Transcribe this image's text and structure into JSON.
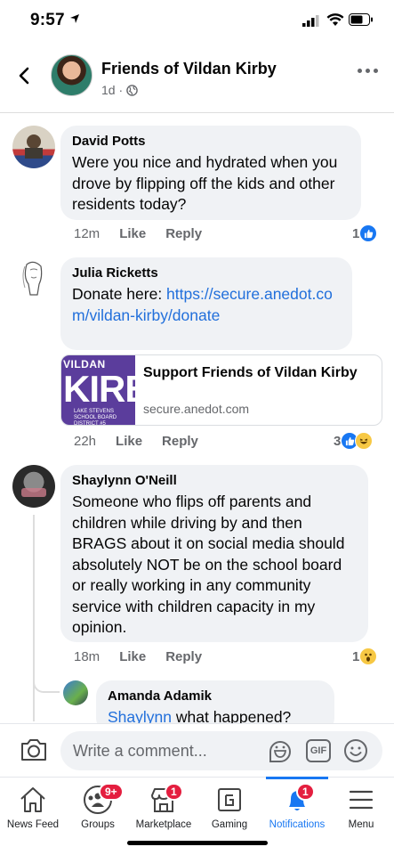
{
  "status_bar": {
    "time": "9:57"
  },
  "header": {
    "title": "Friends of Vildan Kirby",
    "meta": "1d ·"
  },
  "comments": [
    {
      "author": "David Potts",
      "text": "Were you nice and hydrated when you drove by flipping off the kids and other residents today?",
      "time": "12m",
      "like_label": "Like",
      "reply_label": "Reply",
      "reaction_count": "1"
    },
    {
      "author": "Julia Ricketts",
      "text_prefix": "Donate here: ",
      "link": "https://secure.anedot.com/vildan-kirby/donate",
      "time": "22h",
      "like_label": "Like",
      "reply_label": "Reply",
      "reaction_count": "3",
      "card": {
        "title": "Support Friends of Vildan Kirby",
        "domain": "secure.anedot.com",
        "thumb_top": "VILDAN",
        "thumb_main": "KIRBY",
        "thumb_sub": "LAKE STEVENS SCHOOL BOARD DISTRICT #5"
      }
    },
    {
      "author": "Shaylynn O'Neill",
      "text": "Someone who flips off parents and children while driving by and then BRAGS about it on social media should absolutely NOT be on the school board or really working in any community service with children capacity in my opinion.",
      "time": "18m",
      "like_label": "Like",
      "reply_label": "Reply",
      "reaction_count": "1"
    },
    {
      "author": "Amanda Adamik",
      "mention": "Shaylynn",
      "text": " what happened?"
    }
  ],
  "comment_input": {
    "placeholder": "Write a comment...",
    "gif_label": "GIF"
  },
  "tabs": [
    {
      "label": "News Feed",
      "icon": "home-icon"
    },
    {
      "label": "Groups",
      "icon": "groups-icon",
      "badge": "9+"
    },
    {
      "label": "Marketplace",
      "icon": "marketplace-icon",
      "badge": "1"
    },
    {
      "label": "Gaming",
      "icon": "gaming-icon"
    },
    {
      "label": "Notifications",
      "icon": "bell-icon",
      "badge": "1",
      "active": true
    },
    {
      "label": "Menu",
      "icon": "menu-icon"
    }
  ],
  "colors": {
    "accent": "#1877f2",
    "badge": "#e41e3f",
    "bubble": "#f0f2f5",
    "link": "#216fdb"
  }
}
